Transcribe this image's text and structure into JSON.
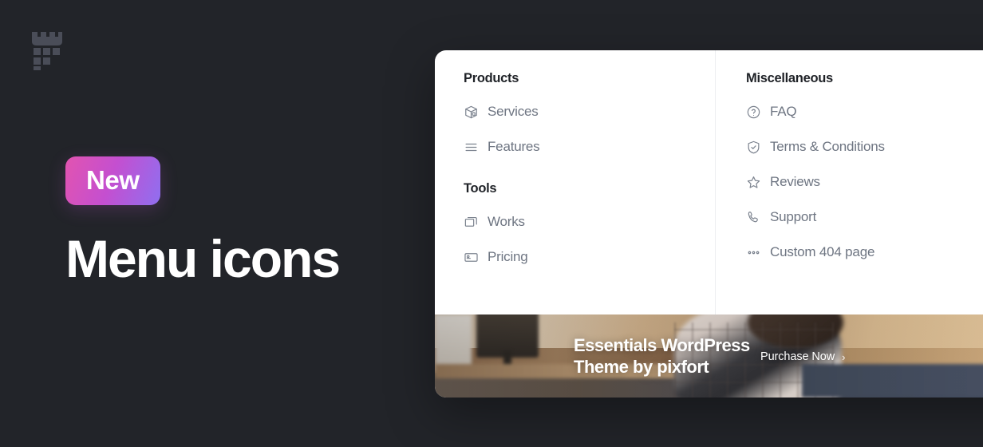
{
  "page": {
    "background_color": "#222429",
    "logo_name": "pixfort-logo"
  },
  "hero": {
    "badge_label": "New",
    "badge_gradient_from": "#e254b0",
    "badge_gradient_to": "#8f6ff0",
    "title": "Menu icons",
    "title_color": "#ffffff"
  },
  "dropdown": {
    "left_column": {
      "groups": [
        {
          "heading": "Products",
          "items": [
            {
              "label": "Services",
              "icon": "package-box-icon"
            },
            {
              "label": "Features",
              "icon": "list-lines-icon"
            }
          ]
        },
        {
          "heading": "Tools",
          "items": [
            {
              "label": "Works",
              "icon": "stacked-windows-icon"
            },
            {
              "label": "Pricing",
              "icon": "credit-card-icon"
            }
          ]
        }
      ]
    },
    "right_column": {
      "groups": [
        {
          "heading": "Miscellaneous",
          "items": [
            {
              "label": "FAQ",
              "icon": "question-circle-icon"
            },
            {
              "label": "Terms & Conditions",
              "icon": "shield-check-icon"
            },
            {
              "label": "Reviews",
              "icon": "star-icon"
            },
            {
              "label": "Support",
              "icon": "phone-icon"
            },
            {
              "label": "Custom 404 page",
              "icon": "ellipsis-icon"
            }
          ]
        }
      ]
    },
    "banner": {
      "title_line1": "Essentials WordPress",
      "title_line2": "Theme by pixfort",
      "cta_label": "Purchase Now",
      "cta_chevron": "›",
      "image_name": "workspace-photo"
    }
  }
}
